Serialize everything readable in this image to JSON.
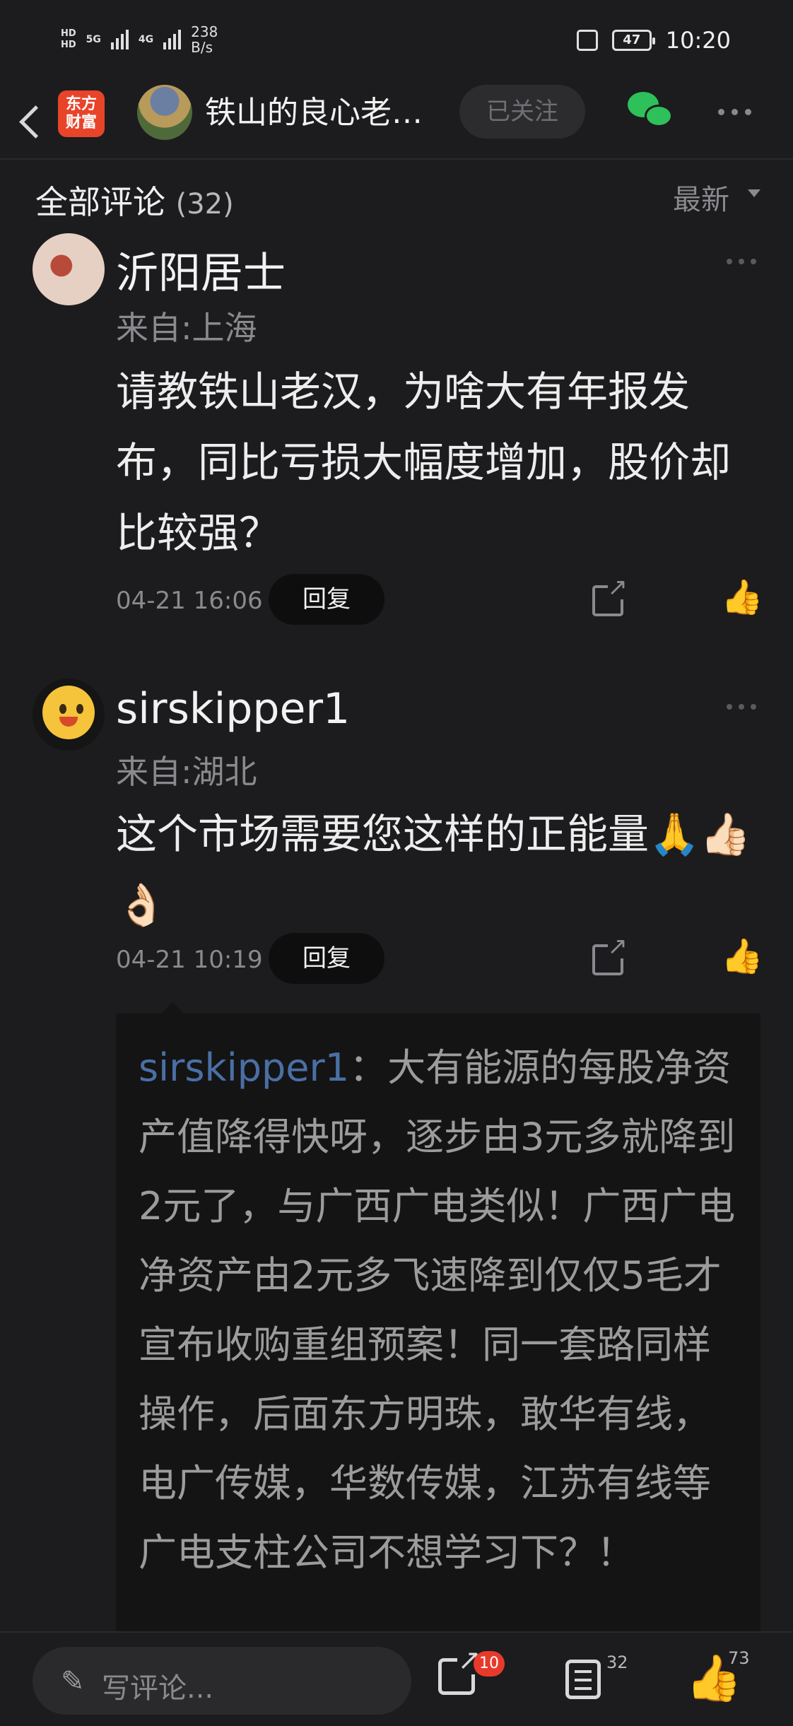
{
  "status_bar": {
    "hd1": "HD",
    "hd2": "HD",
    "net1": "5G",
    "net2": "4G",
    "speed_value": "238",
    "speed_unit": "B/s",
    "battery": "47",
    "time": "10:20"
  },
  "nav": {
    "app_logo_line1": "东方",
    "app_logo_line2": "财富",
    "title": "铁山的良心老…",
    "follow_label": "已关注"
  },
  "comments": {
    "title": "全部评论",
    "count": "(32)",
    "sort_label": "最新",
    "items": [
      {
        "username": "沂阳居士",
        "location": "来自:上海",
        "text": "请教铁山老汉，为啥大有年报发布，同比亏损大幅度增加，股价却比较强？",
        "date": "04-21 16:06",
        "reply_label": "回复"
      },
      {
        "username": "sirskipper1",
        "location": "来自:湖北",
        "text": "这个市场需要您这样的正能量🙏👍🏻👌🏻",
        "date": "04-21 10:19",
        "reply_label": "回复",
        "quoted_reply": {
          "user": "sirskipper1",
          "text": "：大有能源的每股净资产值降得快呀，逐步由3元多就降到2元了，与广西广电类似！广西广电净资产由2元多飞速降到仅仅5毛才宣布收购重组预案！同一套路同样操作，后面东方明珠，敢华有线，电广传媒，华数传媒，江苏有线等广电支柱公司不想学习下？！"
        }
      }
    ]
  },
  "bottom_bar": {
    "input_placeholder": "写评论...",
    "share_badge": "10",
    "comment_count": "32",
    "like_count": "73"
  }
}
